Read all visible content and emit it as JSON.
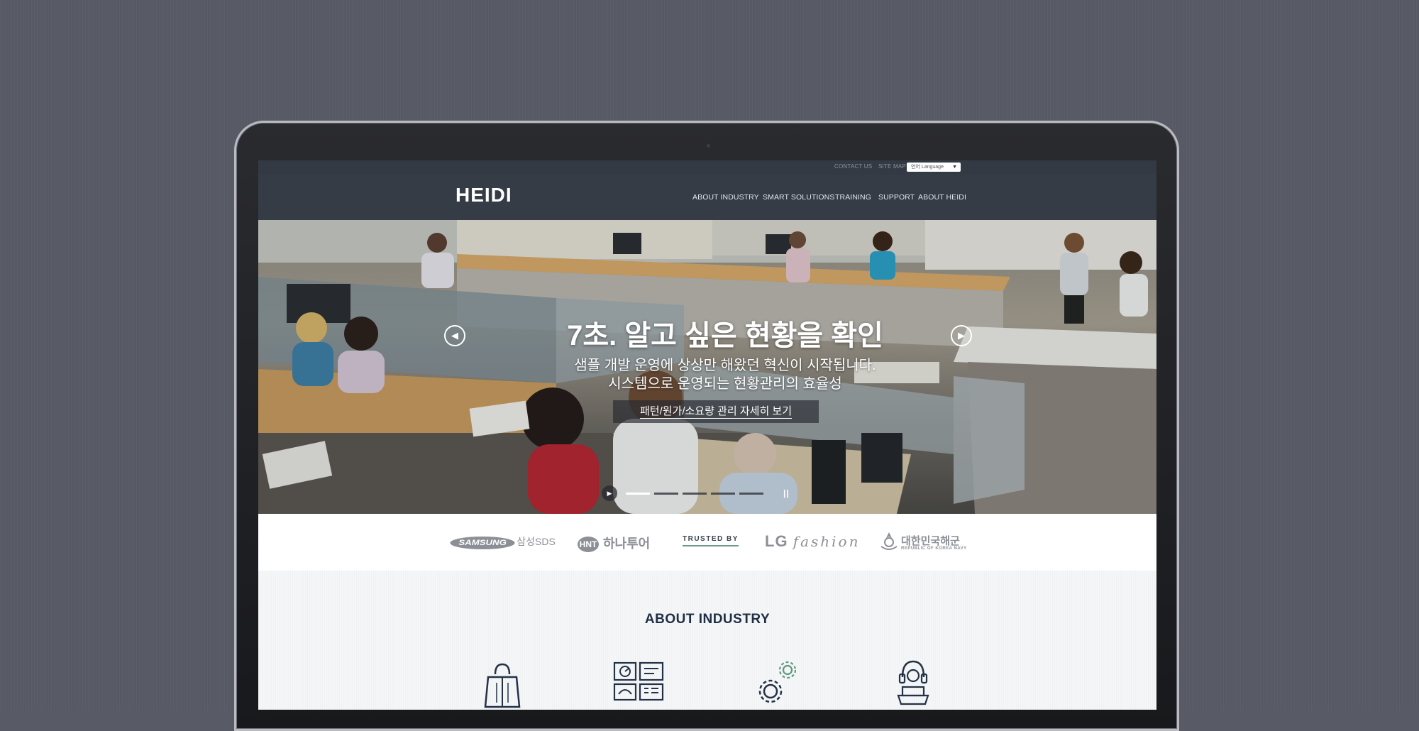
{
  "utility": {
    "contact_us": "CONTACT US",
    "site_map": "SITE MAP",
    "language_select": "언어 Language"
  },
  "nav": {
    "logo": "HEIDI",
    "items": [
      {
        "label": "ABOUT INDUSTRY"
      },
      {
        "label": "SMART SOLUTIONS"
      },
      {
        "label": "TRAINING"
      },
      {
        "label": "SUPPORT"
      },
      {
        "label": "ABOUT HEIDI"
      }
    ]
  },
  "hero": {
    "title": "7초. 알고 싶은 현황을 확인",
    "subtitle_line1": "샘플 개발 운영에 상상만 해왔던 혁신이 시작됩니다.",
    "subtitle_line2": "시스템으로 운영되는 현황관리의 효율성",
    "cta": "패턴/원가/소요량 관리 자세히 보기",
    "slide_count": 5,
    "active_slide": 1
  },
  "partners": {
    "samsung_badge": "SAMSUNG",
    "samsung_text": "삼성SDS",
    "hnt_badge": "HNT",
    "hanatour": "하나투어",
    "trusted_by": "TRUSTED BY",
    "lg_text": "LG",
    "fashion_text": "fashion",
    "navy_korean": "대한민국해군",
    "navy_english": "REPUBLIC OF KOREA NAVY"
  },
  "about": {
    "title": "ABOUT INDUSTRY",
    "icons": [
      "shopping-bag-icon",
      "dashboard-panels-icon",
      "gears-icon",
      "support-headset-icon"
    ]
  },
  "colors": {
    "nav_bg": "#353c46",
    "utility_bg": "#343a43",
    "about_title": "#1f2e44",
    "trusted_underline": "#6d9a87"
  }
}
